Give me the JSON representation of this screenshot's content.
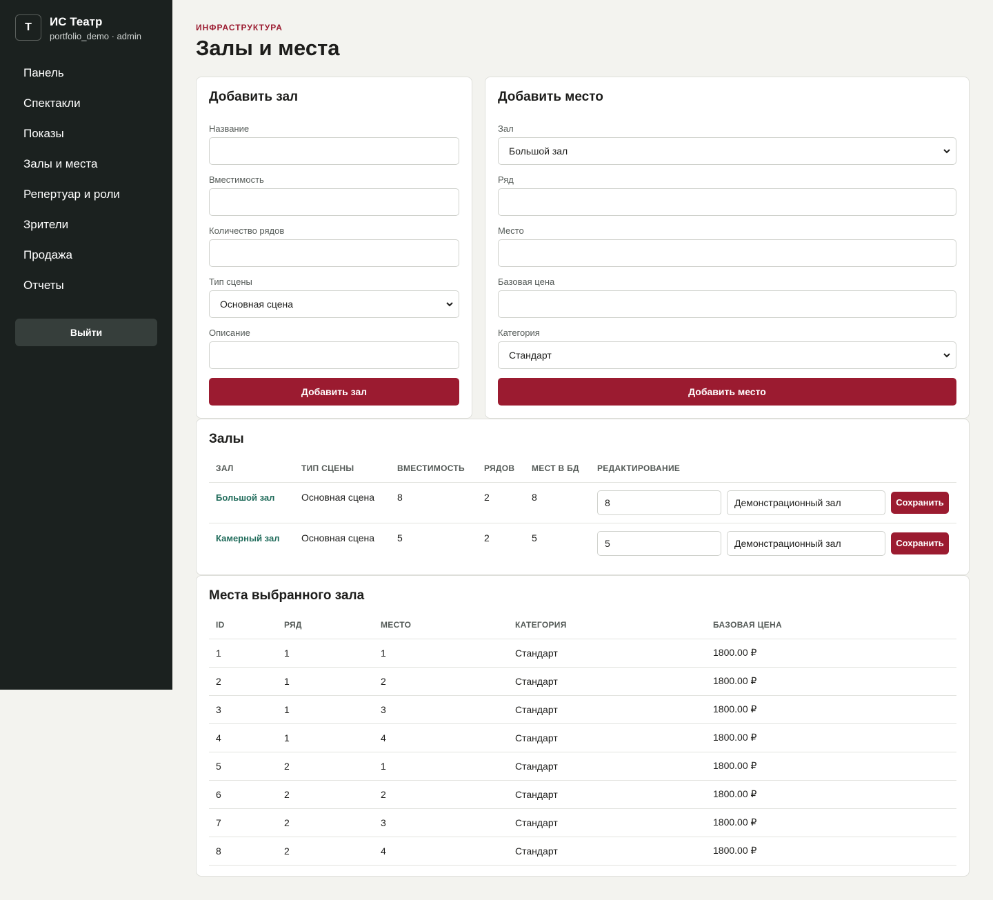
{
  "sidebar": {
    "logo_letter": "Т",
    "title": "ИС Театр",
    "subtitle": "portfolio_demo · admin",
    "items": [
      {
        "label": "Панель"
      },
      {
        "label": "Спектакли"
      },
      {
        "label": "Показы"
      },
      {
        "label": "Залы и места"
      },
      {
        "label": "Репертуар и роли"
      },
      {
        "label": "Зрители"
      },
      {
        "label": "Продажа"
      },
      {
        "label": "Отчеты"
      }
    ],
    "logout_label": "Выйти"
  },
  "header": {
    "eyebrow": "ИНФРАСТРУКТУРА",
    "title": "Залы и места"
  },
  "add_hall": {
    "title": "Добавить зал",
    "name_label": "Название",
    "name_value": "",
    "capacity_label": "Вместимость",
    "capacity_value": "",
    "rows_label": "Количество рядов",
    "rows_value": "",
    "stage_type_label": "Тип сцены",
    "stage_type_value": "Основная сцена",
    "description_label": "Описание",
    "description_value": "",
    "submit_label": "Добавить зал"
  },
  "add_seat": {
    "title": "Добавить место",
    "hall_label": "Зал",
    "hall_value": "Большой зал",
    "row_label": "Ряд",
    "row_value": "",
    "seat_label": "Место",
    "seat_value": "",
    "price_label": "Базовая цена",
    "price_value": "",
    "category_label": "Категория",
    "category_value": "Стандарт",
    "submit_label": "Добавить место"
  },
  "halls": {
    "title": "Залы",
    "columns": [
      "ЗАЛ",
      "ТИП СЦЕНЫ",
      "ВМЕСТИМОСТЬ",
      "РЯДОВ",
      "МЕСТ В БД",
      "РЕДАКТИРОВАНИЕ"
    ],
    "rows": [
      {
        "name": "Большой зал",
        "stage": "Основная сцена",
        "capacity": "8",
        "rows": "2",
        "seats_db": "8",
        "edit_capacity": "8",
        "edit_description": "Демонстрационный зал",
        "save_label": "Сохранить"
      },
      {
        "name": "Камерный зал",
        "stage": "Основная сцена",
        "capacity": "5",
        "rows": "2",
        "seats_db": "5",
        "edit_capacity": "5",
        "edit_description": "Демонстрационный зал",
        "save_label": "Сохранить"
      }
    ]
  },
  "seats": {
    "title": "Места выбранного зала",
    "columns": [
      "ID",
      "РЯД",
      "МЕСТО",
      "КАТЕГОРИЯ",
      "БАЗОВАЯ ЦЕНА"
    ],
    "rows": [
      {
        "id": "1",
        "row": "1",
        "seat": "1",
        "category": "Стандарт",
        "price": "1800.00 ₽"
      },
      {
        "id": "2",
        "row": "1",
        "seat": "2",
        "category": "Стандарт",
        "price": "1800.00 ₽"
      },
      {
        "id": "3",
        "row": "1",
        "seat": "3",
        "category": "Стандарт",
        "price": "1800.00 ₽"
      },
      {
        "id": "4",
        "row": "1",
        "seat": "4",
        "category": "Стандарт",
        "price": "1800.00 ₽"
      },
      {
        "id": "5",
        "row": "2",
        "seat": "1",
        "category": "Стандарт",
        "price": "1800.00 ₽"
      },
      {
        "id": "6",
        "row": "2",
        "seat": "2",
        "category": "Стандарт",
        "price": "1800.00 ₽"
      },
      {
        "id": "7",
        "row": "2",
        "seat": "3",
        "category": "Стандарт",
        "price": "1800.00 ₽"
      },
      {
        "id": "8",
        "row": "2",
        "seat": "4",
        "category": "Стандарт",
        "price": "1800.00 ₽"
      }
    ]
  },
  "colors": {
    "sidebar_bg": "#1b211f",
    "accent": "#9b1b30",
    "link": "#1f6b5a",
    "page_bg": "#f3f3ef"
  },
  "icons": {
    "select_arrow": "chevron-down-icon"
  }
}
